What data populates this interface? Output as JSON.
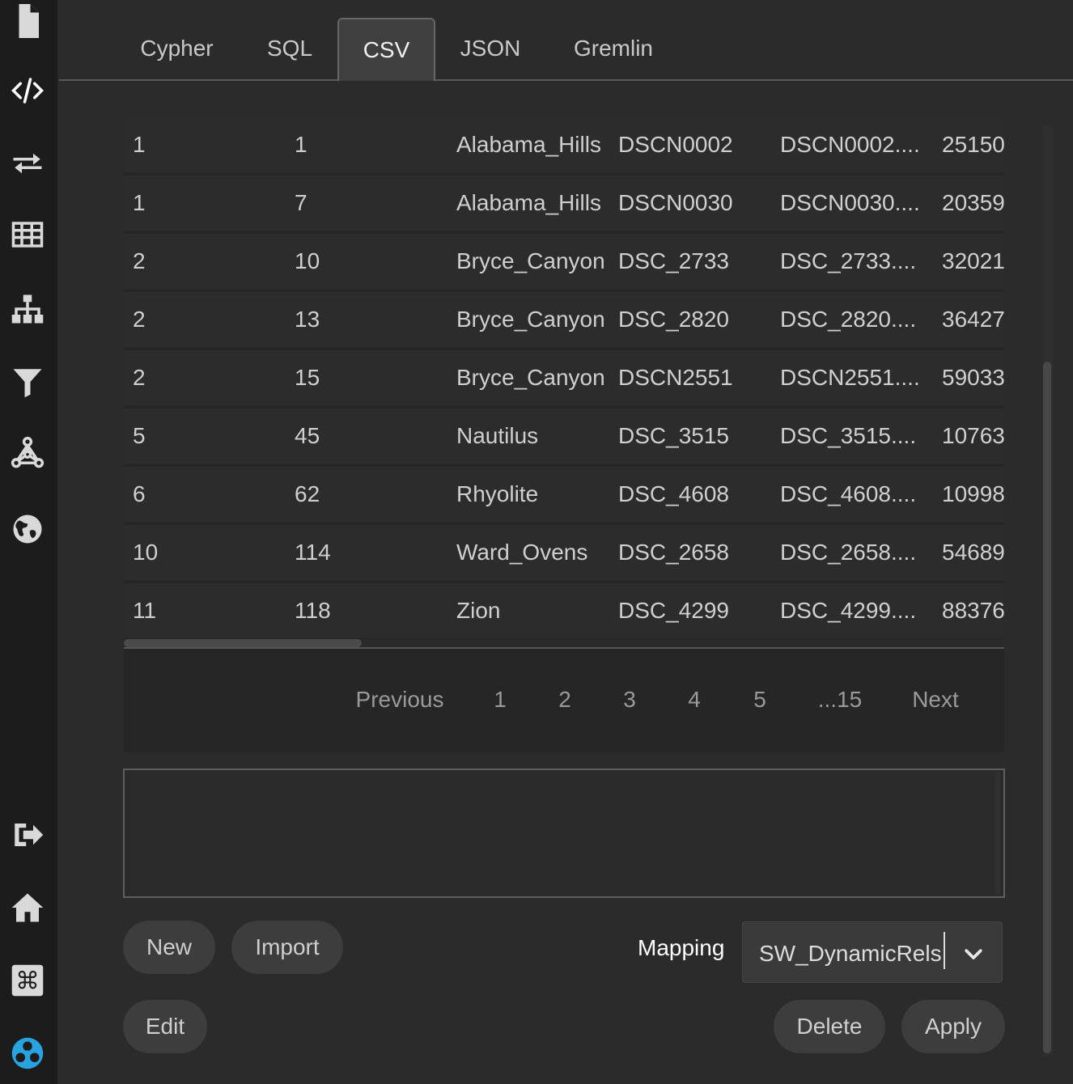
{
  "sidebar": {
    "icons": [
      "file-icon",
      "code-icon",
      "swap-arrows-icon",
      "table-icon",
      "hierarchy-icon",
      "filter-icon",
      "graph-network-icon",
      "globe-icon",
      "sign-out-icon",
      "home-icon",
      "command-key-icon",
      "app-logo-icon"
    ]
  },
  "tabs": [
    {
      "label": "Cypher",
      "active": false
    },
    {
      "label": "SQL",
      "active": false
    },
    {
      "label": "CSV",
      "active": true
    },
    {
      "label": "JSON",
      "active": false
    },
    {
      "label": "Gremlin",
      "active": false
    }
  ],
  "grid": {
    "rows": [
      [
        "1",
        "1",
        "Alabama_Hills",
        "DSCN0002",
        "DSCN0002....",
        "25150"
      ],
      [
        "1",
        "7",
        "Alabama_Hills",
        "DSCN0030",
        "DSCN0030....",
        "20359"
      ],
      [
        "2",
        "10",
        "Bryce_Canyon",
        "DSC_2733",
        "DSC_2733....",
        "32021"
      ],
      [
        "2",
        "13",
        "Bryce_Canyon",
        "DSC_2820",
        "DSC_2820....",
        "36427"
      ],
      [
        "2",
        "15",
        "Bryce_Canyon",
        "DSCN2551",
        "DSCN2551....",
        "59033"
      ],
      [
        "5",
        "45",
        "Nautilus",
        "DSC_3515",
        "DSC_3515....",
        "10763"
      ],
      [
        "6",
        "62",
        "Rhyolite",
        "DSC_4608",
        "DSC_4608....",
        "10998"
      ],
      [
        "10",
        "114",
        "Ward_Ovens",
        "DSC_2658",
        "DSC_2658....",
        "54689"
      ],
      [
        "11",
        "118",
        "Zion",
        "DSC_4299",
        "DSC_4299....",
        "88376"
      ]
    ]
  },
  "pagination": {
    "previous": "Previous",
    "pages": [
      "1",
      "2",
      "3",
      "4",
      "5",
      "...15"
    ],
    "next": "Next"
  },
  "editor": {
    "value": ""
  },
  "buttons": {
    "new": "New",
    "import": "Import",
    "edit": "Edit",
    "delete": "Delete",
    "apply": "Apply"
  },
  "mapping": {
    "label": "Mapping",
    "selected": "SW_DynamicRels"
  }
}
